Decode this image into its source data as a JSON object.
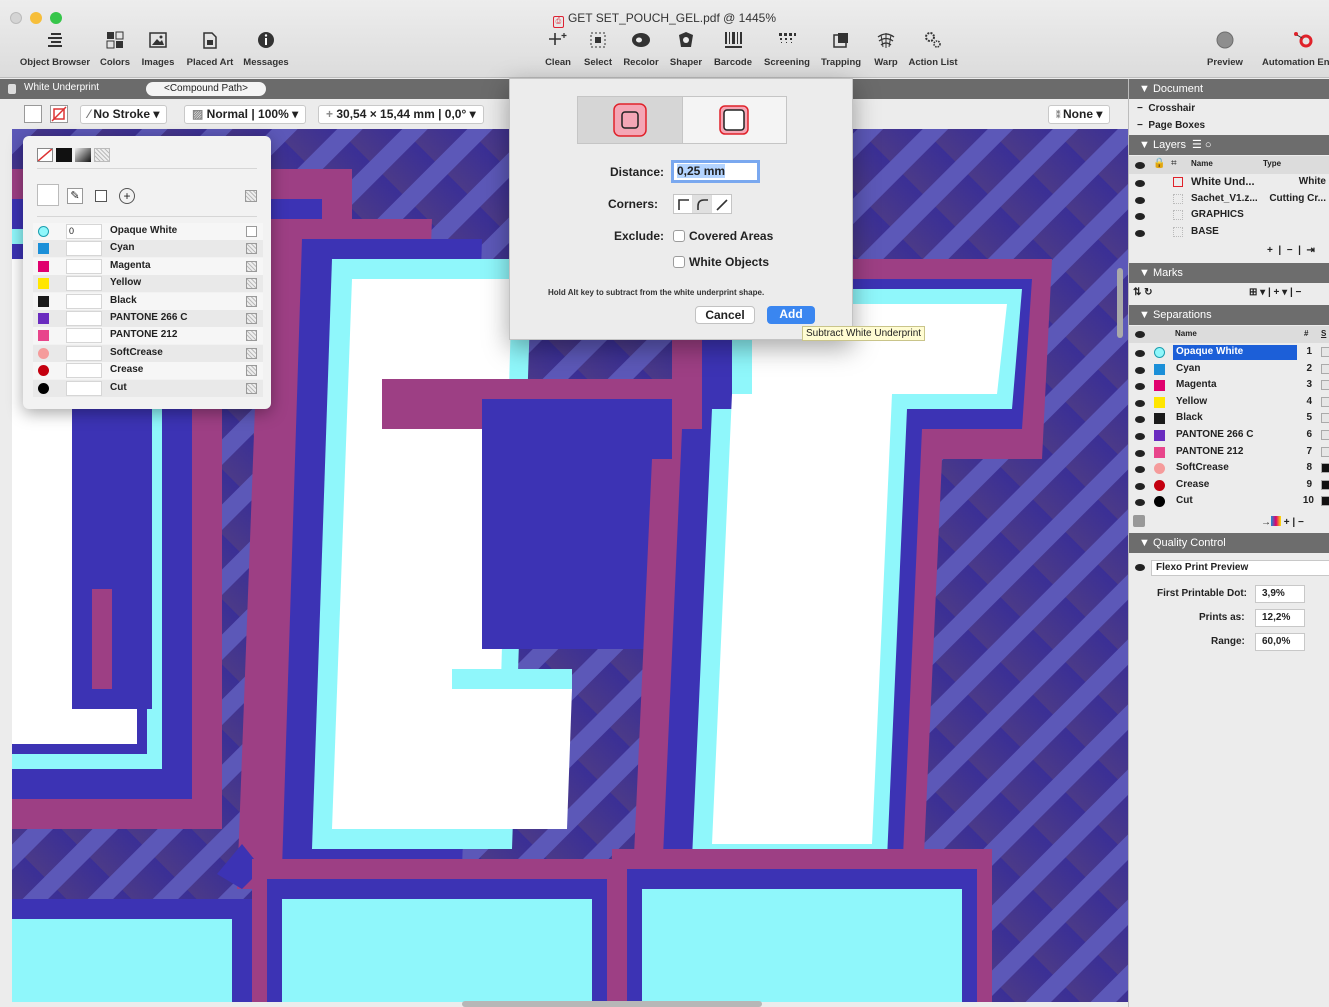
{
  "window": {
    "title": "GET SET_POUCH_GEL.pdf @ 1445%"
  },
  "toolbar": {
    "left": [
      "Object Browser",
      "Colors",
      "Images",
      "Placed Art",
      "Messages"
    ],
    "center": [
      "Clean",
      "Select",
      "Recolor",
      "Shaper",
      "Barcode",
      "Screening",
      "Trapping",
      "Warp",
      "Action List"
    ],
    "right": [
      "Preview",
      "Automation Engi"
    ]
  },
  "context_bar": {
    "layer": "White Underprint",
    "object": "<Compound Path>"
  },
  "properties": {
    "stroke": "No Stroke",
    "blend": "Normal | 100%",
    "transform": "30,54 × 15,44 mm | 0,0° ",
    "preset": "None"
  },
  "swatches": [
    {
      "name": "Opaque White",
      "value": "0",
      "color": "#8ff7fb"
    },
    {
      "name": "Cyan",
      "value": "",
      "color": "#1b8fd8"
    },
    {
      "name": "Magenta",
      "value": "",
      "color": "#e0006e"
    },
    {
      "name": "Yellow",
      "value": "",
      "color": "#ffe600"
    },
    {
      "name": "Black",
      "value": "",
      "color": "#1a1a1a"
    },
    {
      "name": "PANTONE 266 C",
      "value": "",
      "color": "#6a2bbf"
    },
    {
      "name": "PANTONE 212",
      "value": "",
      "color": "#e8458b"
    },
    {
      "name": "SoftCrease",
      "value": "",
      "color": "#f59b9b"
    },
    {
      "name": "Crease",
      "value": "",
      "color": "#c4000f"
    },
    {
      "name": "Cut",
      "value": "",
      "color": "#000000"
    }
  ],
  "dialog": {
    "distance_label": "Distance:",
    "distance_value": "0,25 mm",
    "corners_label": "Corners:",
    "exclude_label": "Exclude:",
    "covered_areas": "Covered Areas",
    "white_objects": "White Objects",
    "hint": "Hold Alt key to subtract from the white underprint shape.",
    "cancel": "Cancel",
    "add": "Add"
  },
  "tooltip": "Subtract White Underprint",
  "panel": {
    "document": "Document",
    "crosshair": "Crosshair",
    "page_boxes": "Page Boxes",
    "layers": "Layers",
    "layer_cols": {
      "name": "Name",
      "type": "Type"
    },
    "layer_rows": [
      {
        "name": "White Und...",
        "type": "White"
      },
      {
        "name": "Sachet_V1.z...",
        "type": "Cutting Cr..."
      },
      {
        "name": "GRAPHICS",
        "type": ""
      },
      {
        "name": "BASE",
        "type": ""
      }
    ],
    "marks": "Marks",
    "separations": "Separations",
    "sep_cols": {
      "name": "Name",
      "num": "#",
      "s": "S"
    },
    "sep_rows": [
      {
        "name": "Opaque White",
        "num": "1",
        "color": "#8ff7fb"
      },
      {
        "name": "Cyan",
        "num": "2",
        "color": "#1b8fd8"
      },
      {
        "name": "Magenta",
        "num": "3",
        "color": "#e0006e"
      },
      {
        "name": "Yellow",
        "num": "4",
        "color": "#ffe600"
      },
      {
        "name": "Black",
        "num": "5",
        "color": "#1a1a1a"
      },
      {
        "name": "PANTONE 266 C",
        "num": "6",
        "color": "#6a2bbf"
      },
      {
        "name": "PANTONE 212",
        "num": "7",
        "color": "#e8458b"
      },
      {
        "name": "SoftCrease",
        "num": "8",
        "color": "#f59b9b"
      },
      {
        "name": "Crease",
        "num": "9",
        "color": "#c4000f"
      },
      {
        "name": "Cut",
        "num": "10",
        "color": "#000000"
      }
    ],
    "quality": "Quality Control",
    "preview_select": "Flexo Print Preview",
    "first_dot_label": "First Printable Dot:",
    "first_dot": "3,9%",
    "prints_as_label": "Prints as:",
    "prints_as": "12,2%",
    "range_label": "Range:",
    "range": "60,0%"
  }
}
